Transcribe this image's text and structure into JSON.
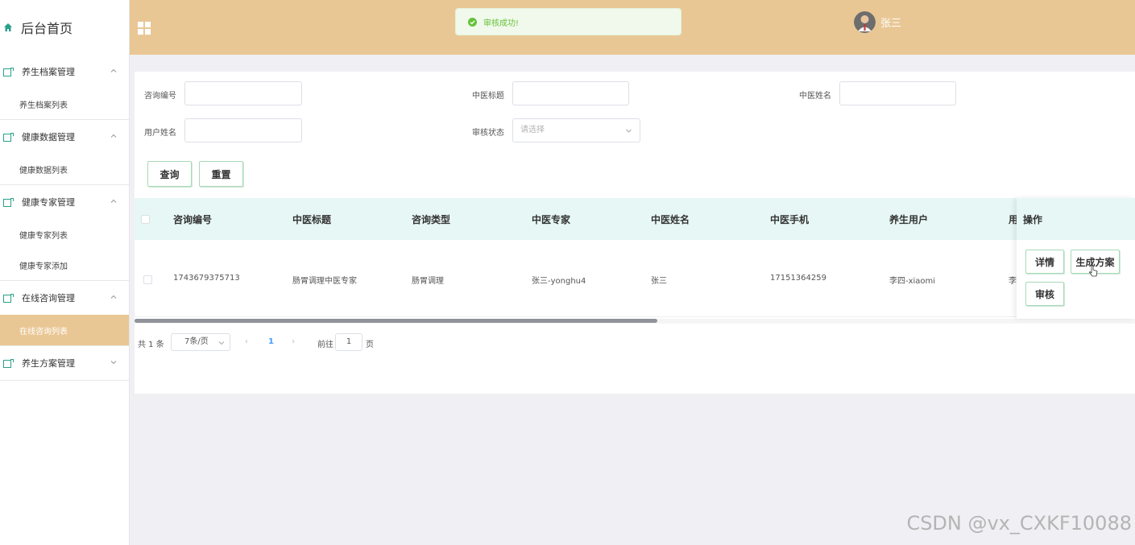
{
  "sidebar": {
    "brand": "后台首页",
    "groups": [
      {
        "label": "养生档案管理",
        "items": [
          "养生档案列表"
        ]
      },
      {
        "label": "健康数据管理",
        "items": [
          "健康数据列表"
        ]
      },
      {
        "label": "健康专家管理",
        "items": [
          "健康专家列表",
          "健康专家添加"
        ]
      },
      {
        "label": "在线咨询管理",
        "items": [
          "在线咨询列表"
        ]
      },
      {
        "label": "养生方案管理",
        "items": []
      }
    ]
  },
  "header": {
    "toast": "审核成功!",
    "user_name": "张三"
  },
  "filters": {
    "consult_no_label": "咨询编号",
    "tcm_title_label": "中医标题",
    "tcm_name_label": "中医姓名",
    "user_name_label": "用户姓名",
    "audit_status_label": "审核状态",
    "audit_status_placeholder": "请选择",
    "query_button": "查询",
    "reset_button": "重置"
  },
  "table": {
    "columns": [
      "咨询编号",
      "中医标题",
      "咨询类型",
      "中医专家",
      "中医姓名",
      "中医手机",
      "养生用户",
      "用"
    ],
    "ops_header": "操作",
    "rows": [
      {
        "cells": [
          "1743679375713",
          "肠胃调理中医专家",
          "肠胃调理",
          "张三-yonghu4",
          "张三",
          "17151364259",
          "李四-xiaomi",
          "李"
        ],
        "actions": {
          "detail": "详情",
          "plan": "生成方案",
          "audit": "审核"
        }
      }
    ]
  },
  "pagination": {
    "total": "共 1 条",
    "page_size": "7条/页",
    "prev": "‹",
    "current": "1",
    "next": "›",
    "goto_label": "前往",
    "goto_value": "1",
    "goto_suffix": "页"
  },
  "watermark": "CSDN @vx_CXKF10088",
  "colors": {
    "accent": "#e9c795",
    "table_header": "#e6f7f5",
    "success": "#67c23a",
    "button_border": "#a8d8b9"
  }
}
